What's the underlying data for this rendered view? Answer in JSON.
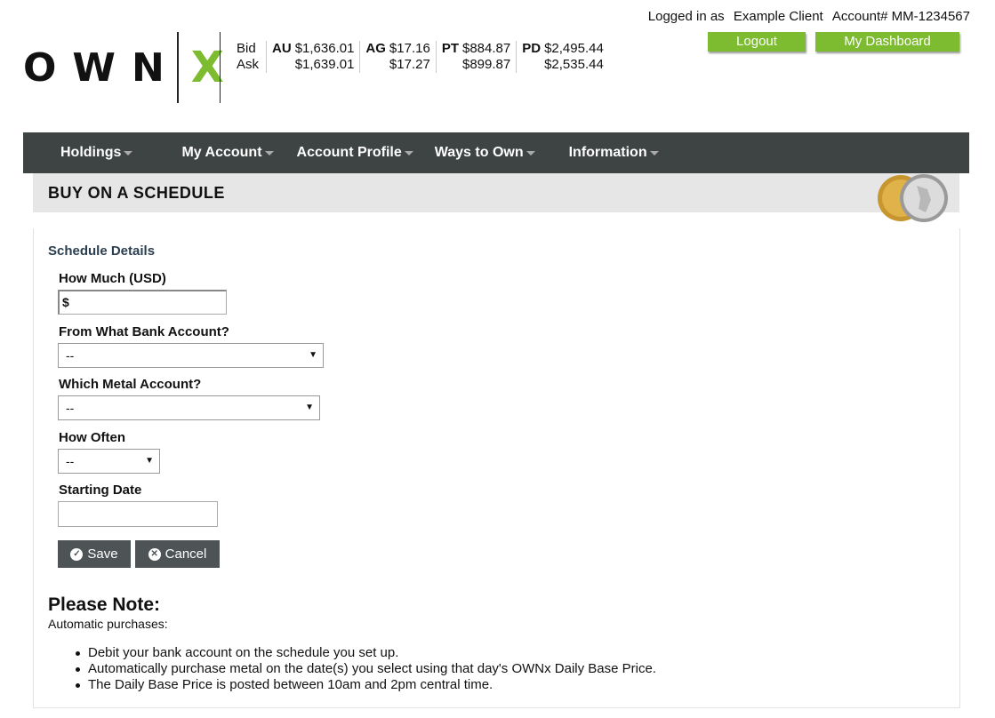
{
  "account": {
    "logged_in_label": "Logged in as",
    "client_name": "Example Client",
    "account_label": "Account# MM-1234567"
  },
  "header_buttons": {
    "logout": "Logout",
    "dashboard": "My Dashboard"
  },
  "logo": {
    "own": "OWN",
    "x": "X"
  },
  "prices": {
    "bid_label": "Bid",
    "ask_label": "Ask",
    "metals": [
      {
        "symbol": "AU",
        "bid": "$1,636.01",
        "ask": "$1,639.01"
      },
      {
        "symbol": "AG",
        "bid": "$17.16",
        "ask": "$17.27"
      },
      {
        "symbol": "PT",
        "bid": "$884.87",
        "ask": "$899.87"
      },
      {
        "symbol": "PD",
        "bid": "$2,495.44",
        "ask": "$2,535.44"
      }
    ]
  },
  "nav": {
    "items": [
      "Holdings",
      "My Account",
      "Account Profile",
      "Ways to Own",
      "Information"
    ]
  },
  "page_title": "BUY ON A SCHEDULE",
  "form": {
    "section_title": "Schedule Details",
    "how_much_label": "How Much (USD)",
    "how_much_value": "$",
    "bank_label": "From What Bank Account?",
    "bank_value": "--",
    "metal_label": "Which Metal Account?",
    "metal_value": "--",
    "often_label": "How Often",
    "often_value": "--",
    "date_label": "Starting Date",
    "date_value": "",
    "save_label": "Save",
    "cancel_label": "Cancel"
  },
  "note": {
    "title": "Please Note:",
    "subtitle": "Automatic purchases:",
    "items": [
      "Debit your bank account on the schedule you set up.",
      "Automatically purchase metal on the date(s) you select using that day's OWNx Daily Base Price.",
      "The Daily Base Price is posted between 10am and 2pm central time."
    ]
  },
  "colors": {
    "brand_green": "#7dbb31",
    "nav_bg": "#3e4344",
    "button_dark": "#4e5455"
  }
}
